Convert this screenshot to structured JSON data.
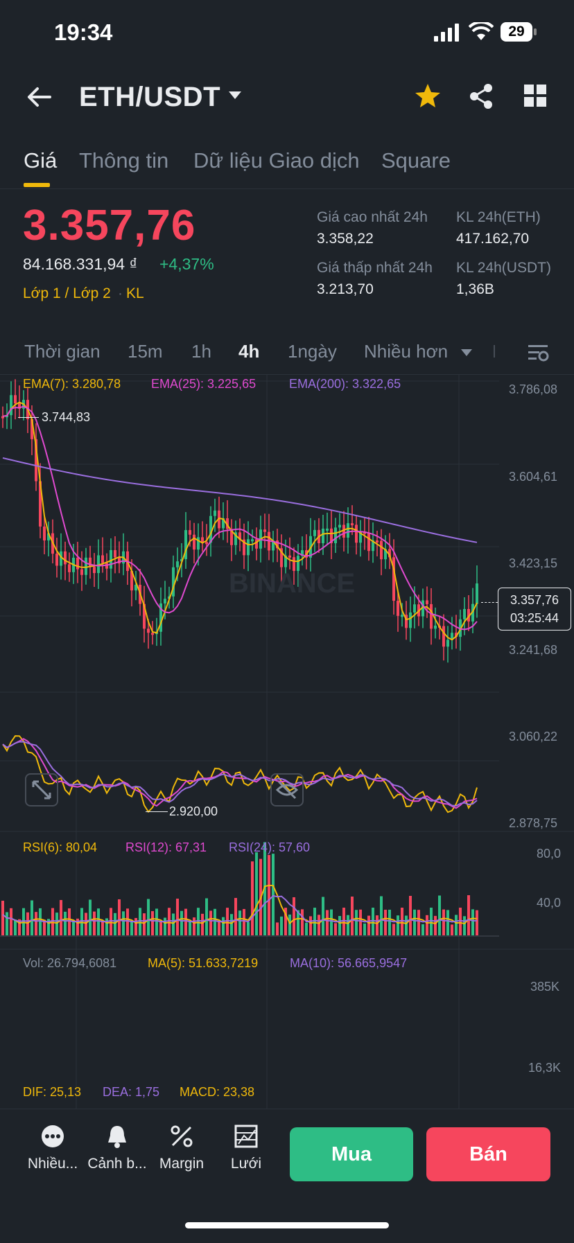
{
  "status_bar": {
    "time": "19:34",
    "battery": "29"
  },
  "header": {
    "pair": "ETH/USDT",
    "icons": [
      "back-arrow-icon",
      "caret-down-icon",
      "star-icon",
      "share-icon",
      "grid-icon"
    ]
  },
  "tabs": [
    {
      "label": "Giá"
    },
    {
      "label": "Thông tin"
    },
    {
      "label": "Dữ liệu Giao dịch"
    },
    {
      "label": "Square"
    }
  ],
  "ticker": {
    "price": "3.357,76",
    "fiat": "84.168.331,94 ₫",
    "change": "+4,37%",
    "layer": "Lớp 1 / Lớp 2",
    "vol_tag": "KL",
    "high_label": "Giá cao nhất 24h",
    "high_value": "3.358,22",
    "low_label": "Giá thấp nhất 24h",
    "low_value": "3.213,70",
    "vol_eth_label": "KL 24h(ETH)",
    "vol_eth_value": "417.162,70",
    "vol_usdt_label": "KL 24h(USDT)",
    "vol_usdt_value": "1,36B"
  },
  "intervals": [
    {
      "label": "Thời gian"
    },
    {
      "label": "15m"
    },
    {
      "label": "1h"
    },
    {
      "label": "4h"
    },
    {
      "label": "1ngày"
    },
    {
      "label": "Nhiều hơn"
    }
  ],
  "colors": {
    "up": "#2ebd85",
    "down": "#f6465d",
    "ema7": "#f0b90b",
    "ema25": "#e04ad0",
    "ema200": "#9b6fe0",
    "accent": "#f0b90b"
  },
  "chart": {
    "ema7": "EMA(7): 3.280,78",
    "ema25": "EMA(25): 3.225,65",
    "ema200": "EMA(200): 3.322,65",
    "price_ticks": [
      "3.786,08",
      "3.604,61",
      "3.423,15",
      "3.241,68",
      "3.060,22",
      "2.878,75"
    ],
    "high_marker": "3.744,83",
    "low_marker": "2.920,00",
    "current_price": "3.357,76",
    "countdown": "03:25:44",
    "watermark": "BINANCE",
    "rsi6": "RSI(6): 80,04",
    "rsi12": "RSI(12): 67,31",
    "rsi24": "RSI(24): 57,60",
    "rsi_ticks": [
      "80,0",
      "40,0"
    ],
    "vol": "Vol: 26.794,6081",
    "ma5": "MA(5): 51.633,7219",
    "ma10": "MA(10): 56.665,9547",
    "vol_ticks": [
      "385K",
      "16,3K"
    ],
    "dif": "DIF: 25,13",
    "dea": "DEA: 1,75",
    "macd": "MACD: 23,38"
  },
  "bottom_nav": [
    {
      "label": "Nhiều...",
      "icon": "more-icon"
    },
    {
      "label": "Cảnh b...",
      "icon": "bell-icon"
    },
    {
      "label": "Margin",
      "icon": "margin-icon"
    },
    {
      "label": "Lưới",
      "icon": "grid-bot-icon"
    }
  ],
  "actions": {
    "buy": "Mua",
    "sell": "Bán"
  }
}
